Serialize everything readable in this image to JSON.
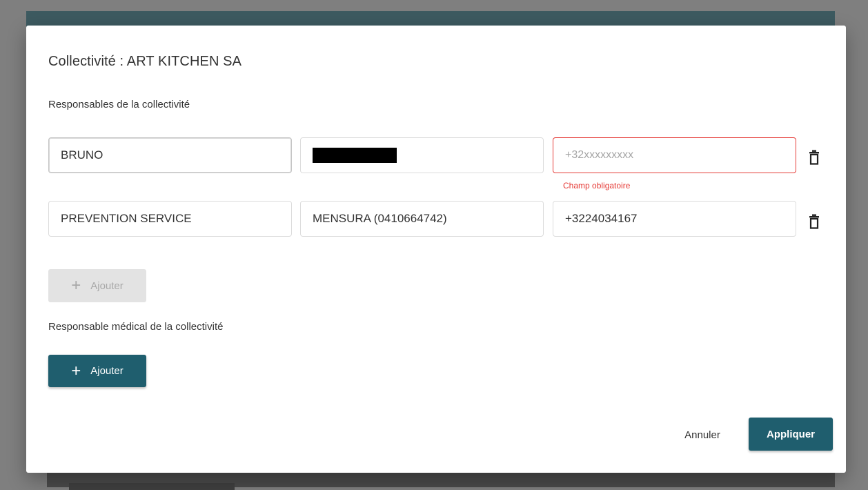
{
  "dialog": {
    "title": "Collectivité : ART KITCHEN SA",
    "section_responsables": "Responsables de la collectivité",
    "section_medical": "Responsable médical de la collectivité",
    "rows": [
      {
        "name": "BRUNO",
        "organization": "",
        "phone": "",
        "phone_placeholder": "+32xxxxxxxxx",
        "error": "Champ obligatoire"
      },
      {
        "name": "PREVENTION SERVICE",
        "organization": "MENSURA (0410664742)",
        "phone": "+3224034167",
        "phone_placeholder": "+32xxxxxxxxx"
      }
    ],
    "add_label": "Ajouter",
    "add_medical_label": "Ajouter",
    "cancel_label": "Annuler",
    "apply_label": "Appliquer"
  },
  "colors": {
    "primary": "#1f5e6e",
    "error": "#e53935",
    "header_strip": "#3d5a60"
  },
  "icons": {
    "delete": "trash-icon",
    "add": "plus-icon"
  }
}
